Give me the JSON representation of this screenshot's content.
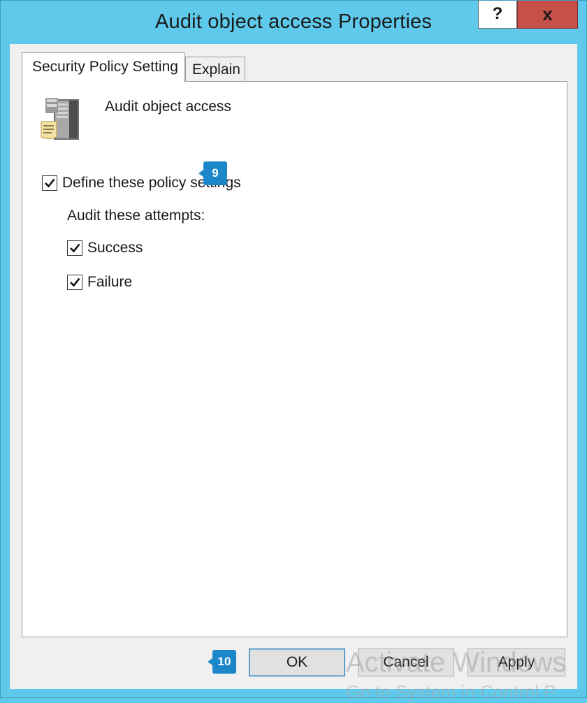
{
  "window": {
    "title": "Audit object access Properties",
    "help_label": "?",
    "close_label": "x"
  },
  "tabs": [
    {
      "label": "Security Policy Setting",
      "active": true
    },
    {
      "label": "Explain",
      "active": false
    }
  ],
  "policy": {
    "icon": "server-policy-icon",
    "name": "Audit object access",
    "define_label": "Define these policy settings",
    "define_checked": true,
    "attempts_label": "Audit these attempts:",
    "success_label": "Success",
    "success_checked": true,
    "failure_label": "Failure",
    "failure_checked": true
  },
  "callouts": {
    "step_9": "9",
    "step_10": "10"
  },
  "buttons": {
    "ok": "OK",
    "cancel": "Cancel",
    "apply": "Apply"
  },
  "watermark": {
    "line1": "Activate Windows",
    "line2": "Go to System in Control P"
  },
  "colors": {
    "title_bar": "#5ec9ea",
    "close_button": "#c7504a",
    "callout": "#1b87c9"
  }
}
